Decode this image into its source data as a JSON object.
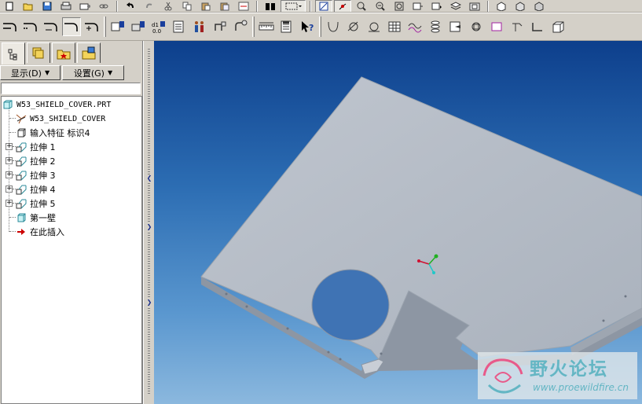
{
  "panel": {
    "tabs": [
      "model-tree-tab",
      "layers-tab",
      "favorites-tab",
      "folder-tab"
    ],
    "show_menu": {
      "label": "显示(D)"
    },
    "settings_menu": {
      "label": "设置(G)"
    }
  },
  "tree": {
    "root": "W53_SHIELD_COVER.PRT",
    "items": [
      {
        "label": "W53_SHIELD_COVER",
        "icon": "csys-icon",
        "expandable": false
      },
      {
        "label": "输入特征 标识4",
        "icon": "import-feature-icon",
        "expandable": false
      },
      {
        "label": "拉伸 1",
        "icon": "extrude-icon",
        "expandable": true
      },
      {
        "label": "拉伸 2",
        "icon": "extrude-icon",
        "expandable": true
      },
      {
        "label": "拉伸 3",
        "icon": "extrude-icon",
        "expandable": true
      },
      {
        "label": "拉伸 4",
        "icon": "extrude-icon",
        "expandable": true
      },
      {
        "label": "拉伸 5",
        "icon": "extrude-icon",
        "expandable": true
      },
      {
        "label": "第一壁",
        "icon": "first-wall-icon",
        "expandable": false
      },
      {
        "label": "在此插入",
        "icon": "insert-here-arrow-icon",
        "expandable": false
      }
    ]
  },
  "watermark": {
    "chinese": "野火论坛",
    "url": "www.proewildfire.cn"
  },
  "colors": {
    "viewport_top": "#0d3f8c",
    "viewport_bottom": "#8bb8de",
    "part": "#b6bcc5",
    "insert_arrow": "#cc0000"
  }
}
